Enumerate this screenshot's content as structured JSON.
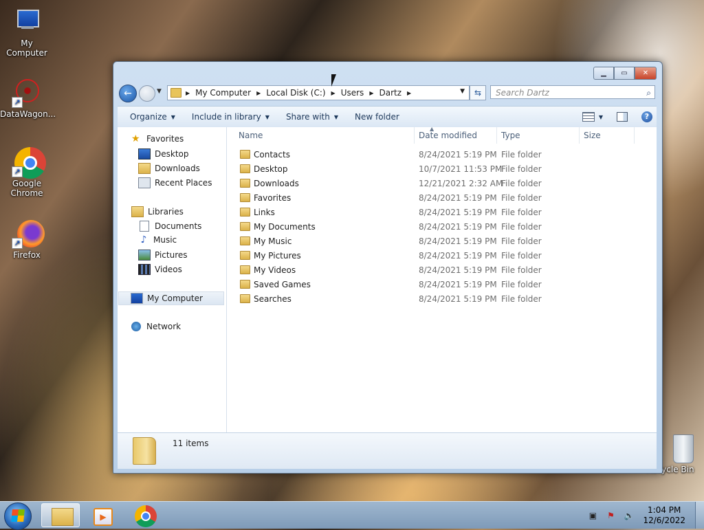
{
  "desktop": {
    "icons": [
      {
        "label": "My Computer"
      },
      {
        "label": "DataWagon..."
      },
      {
        "label": "Google Chrome"
      },
      {
        "label": "Firefox"
      },
      {
        "label": "Recycle Bin"
      }
    ]
  },
  "window": {
    "address": {
      "crumbs": [
        "My Computer",
        "Local Disk (C:)",
        "Users",
        "Dartz"
      ]
    },
    "search_placeholder": "Search Dartz",
    "toolbar": {
      "organize": "Organize",
      "include_in_library": "Include in library",
      "share_with": "Share with",
      "new_folder": "New folder"
    },
    "nav": {
      "favorites": "Favorites",
      "desktop": "Desktop",
      "downloads": "Downloads",
      "recent_places": "Recent Places",
      "libraries": "Libraries",
      "documents": "Documents",
      "music": "Music",
      "pictures": "Pictures",
      "videos": "Videos",
      "my_computer": "My Computer",
      "network": "Network"
    },
    "columns": {
      "name": "Name",
      "date_modified": "Date modified",
      "type": "Type",
      "size": "Size"
    },
    "files": [
      {
        "name": "Contacts",
        "date": "8/24/2021 5:19 PM",
        "type": "File folder"
      },
      {
        "name": "Desktop",
        "date": "10/7/2021 11:53 PM",
        "type": "File folder"
      },
      {
        "name": "Downloads",
        "date": "12/21/2021 2:32 AM",
        "type": "File folder"
      },
      {
        "name": "Favorites",
        "date": "8/24/2021 5:19 PM",
        "type": "File folder"
      },
      {
        "name": "Links",
        "date": "8/24/2021 5:19 PM",
        "type": "File folder"
      },
      {
        "name": "My Documents",
        "date": "8/24/2021 5:19 PM",
        "type": "File folder"
      },
      {
        "name": "My Music",
        "date": "8/24/2021 5:19 PM",
        "type": "File folder"
      },
      {
        "name": "My Pictures",
        "date": "8/24/2021 5:19 PM",
        "type": "File folder"
      },
      {
        "name": "My Videos",
        "date": "8/24/2021 5:19 PM",
        "type": "File folder"
      },
      {
        "name": "Saved Games",
        "date": "8/24/2021 5:19 PM",
        "type": "File folder"
      },
      {
        "name": "Searches",
        "date": "8/24/2021 5:19 PM",
        "type": "File folder"
      }
    ],
    "status_count": "11 items"
  },
  "taskbar": {
    "time": "1:04 PM",
    "date": "12/6/2022"
  }
}
